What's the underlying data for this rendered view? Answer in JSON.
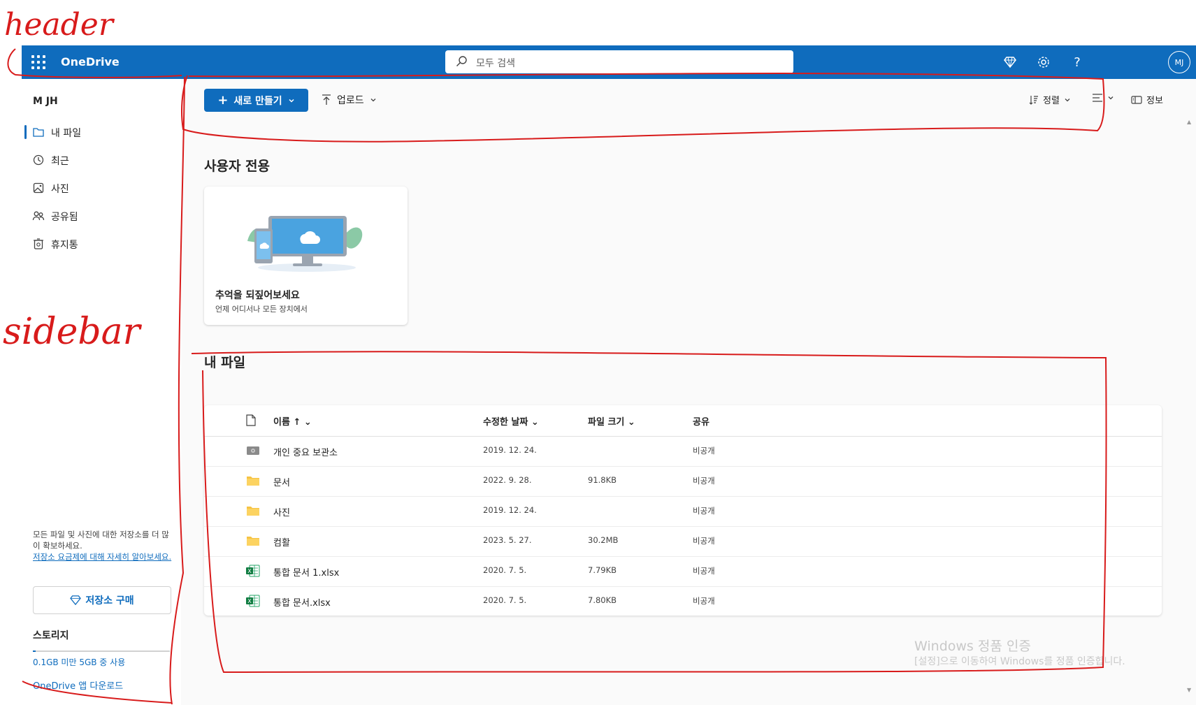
{
  "header": {
    "app_name": "OneDrive",
    "search_placeholder": "모두 검색",
    "avatar_initials": "MJ",
    "accent": "#0f6cbd"
  },
  "sidebar": {
    "user_name": "M JH",
    "items": [
      {
        "label": "내 파일",
        "icon": "folder-icon",
        "active": true
      },
      {
        "label": "최근",
        "icon": "history-icon",
        "active": false
      },
      {
        "label": "사진",
        "icon": "image-icon",
        "active": false
      },
      {
        "label": "공유됨",
        "icon": "people-icon",
        "active": false
      },
      {
        "label": "휴지통",
        "icon": "recycle-bin-icon",
        "active": false
      }
    ],
    "promo_text": "모든 파일 및 사진에 대한 저장소를 더 많이 확보하세요.",
    "promo_link": "저장소 요금제에 대해 자세히 알아보세요.",
    "buy_label": "저장소 구매",
    "storage_title": "스토리지",
    "storage_used": "0.1GB 미만 5GB 중 사용",
    "storage_fraction": 0.02,
    "app_download": "OneDrive 앱 다운로드"
  },
  "toolbar": {
    "new_label": "새로 만들기",
    "upload_label": "업로드",
    "sort_label": "정렬",
    "info_label": "정보"
  },
  "for_you": {
    "title": "사용자 전용",
    "card_title": "추억을 되짚어보세요",
    "card_subtitle": "언제 어디서나 모든 장치에서"
  },
  "my_files": {
    "title": "내 파일",
    "columns": {
      "name": "이름 ↑",
      "modified": "수정한 날짜",
      "size": "파일 크기",
      "sharing": "공유"
    },
    "rows": [
      {
        "icon": "vault-icon",
        "name": "개인 중요 보관소",
        "modified": "2019. 12. 24.",
        "size": "",
        "sharing": "비공개"
      },
      {
        "icon": "folder-icon",
        "name": "문서",
        "modified": "2022. 9. 28.",
        "size": "91.8KB",
        "sharing": "비공개"
      },
      {
        "icon": "folder-icon",
        "name": "사진",
        "modified": "2019. 12. 24.",
        "size": "",
        "sharing": "비공개"
      },
      {
        "icon": "folder-icon",
        "name": "컴활",
        "modified": "2023. 5. 27.",
        "size": "30.2MB",
        "sharing": "비공개"
      },
      {
        "icon": "excel-icon",
        "name": "통합 문서 1.xlsx",
        "modified": "2020. 7. 5.",
        "size": "7.79KB",
        "sharing": "비공개"
      },
      {
        "icon": "excel-icon",
        "name": "통합 문서.xlsx",
        "modified": "2020. 7. 5.",
        "size": "7.80KB",
        "sharing": "비공개"
      }
    ]
  },
  "annotations": {
    "header": "header",
    "sidebar": "sidebar"
  },
  "watermark": {
    "line1": "Windows 정품 인증",
    "line2": "[설정]으로 이동하여 Windows를 정품 인증합니다."
  }
}
